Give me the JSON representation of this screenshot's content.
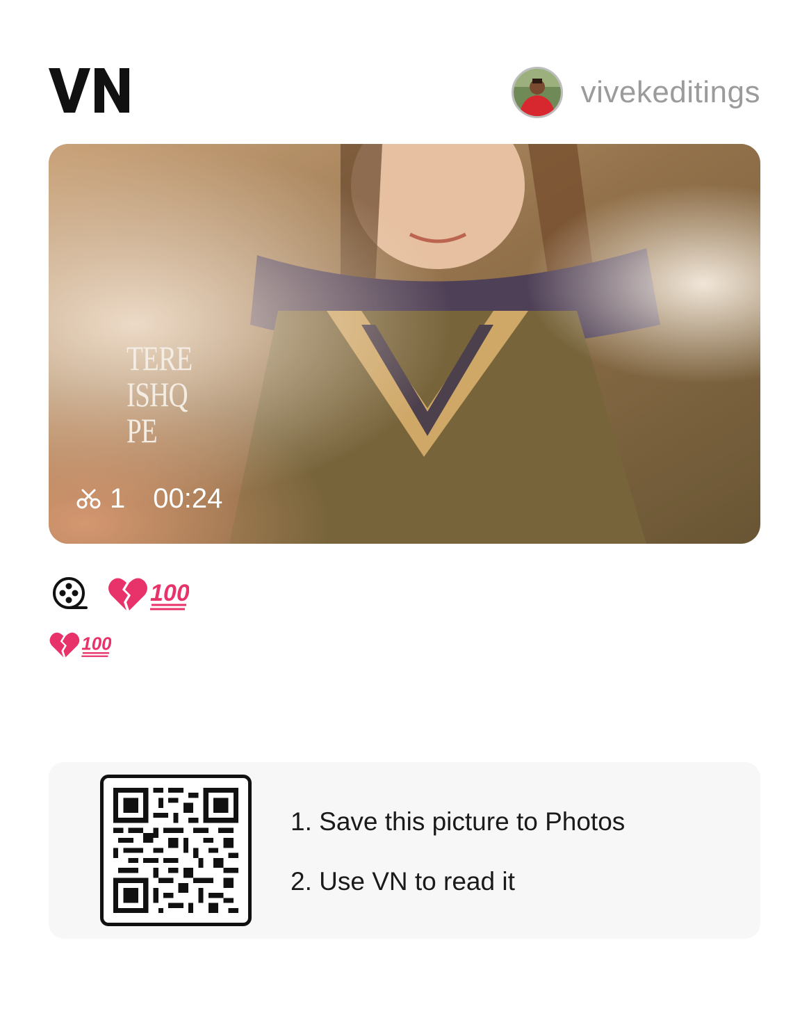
{
  "header": {
    "logo_text": "VN",
    "username": "vivekeditings"
  },
  "video": {
    "overlay_lines": [
      "TERE",
      "ISHQ",
      "PE"
    ],
    "clip_count": "1",
    "duration": "00:24"
  },
  "caption": {
    "emoji_text": "💔💯",
    "description": "💔💯"
  },
  "qr_card": {
    "step1": "1. Save this picture to Photos",
    "step2": "2. Use VN to read it"
  },
  "colors": {
    "brand": "#111111",
    "username": "#9b9b9b",
    "card_bg": "#f7f7f7",
    "heart": "#e8336a"
  }
}
